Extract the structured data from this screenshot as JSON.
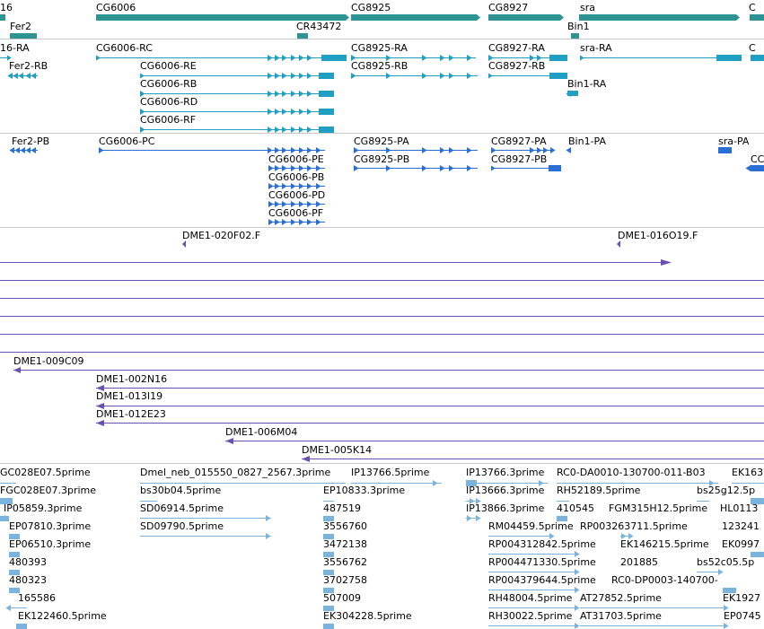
{
  "colors": {
    "gene": "#2e9393",
    "transcript": "#1f9fc1",
    "protein": "#2a6fd6",
    "clone": "#6a4fb5",
    "est": "#7ab3dd",
    "divider": "#c8c8c8"
  },
  "tracks": {
    "genes": {
      "labels": [
        "16",
        "CG6006",
        "CG8925",
        "CG8927",
        "sra",
        "C",
        "Fer2",
        "CR43472",
        "Bin1"
      ]
    },
    "transcripts": {
      "labels": [
        "16-RA",
        "CG6006-RC",
        "CG8925-RA",
        "CG8927-RA",
        "sra-RA",
        "C",
        "Fer2-RB",
        "CG6006-RE",
        "CG8925-RB",
        "CG8927-RB",
        "CG6006-RB",
        "Bin1-RA",
        "CG6006-RD",
        "CG6006-RF"
      ]
    },
    "proteins": {
      "labels": [
        "Fer2-PB",
        "CG6006-PC",
        "CG8925-PA",
        "CG8927-PA",
        "Bin1-PA",
        "sra-PA",
        "CC",
        "CG6006-PE",
        "CG8925-PB",
        "CG8927-PB",
        "CG6006-PB",
        "CG6006-PD",
        "CG6006-PF"
      ]
    },
    "clones": {
      "labels": [
        "DME1-020F02.F",
        "DME1-016O19.F",
        "DME1-009C09",
        "DME1-002N16",
        "DME1-013I19",
        "DME1-012E23",
        "DME1-006M04",
        "DME1-005K14"
      ]
    },
    "ests": {
      "labels": [
        "GC028E07.5prime",
        "Dmel_neb_015550_0827_2567.3prime",
        "IP13766.5prime",
        "IP13766.3prime",
        "RC0-DA0010-130700-011-B03",
        "EK163",
        "FGC028E07.3prime",
        "bs30b04.5prime",
        "EP10833.3prime",
        "IP13666.3prime",
        "RH52189.5prime",
        "bs25g12.5p",
        "IP05859.3prime",
        "SD06914.5prime",
        "487519",
        "IP13866.3prime",
        "410545",
        "FGM315H12.5prime",
        "HL0113",
        "EP07810.3prime",
        "SD09790.5prime",
        "3556760",
        "RM04459.5prime",
        "RP003263711.5prime",
        "123241",
        "EP06510.3prime",
        "3472138",
        "RP004312842.5prime",
        "EK146215.5prime",
        "EK0997",
        "480393",
        "3556762",
        "RP004471330.5prime",
        "201885",
        "bs52c05.5p",
        "480323",
        "3702758",
        "RP004379644.5prime",
        "RC0-DP0003-140700-",
        "165586",
        "507009",
        "RH48004.5prime",
        "AT27852.5prime",
        "EK1927",
        "EK122460.5prime",
        "EK304228.5prime",
        "RH30022.5prime",
        "AT31703.5prime",
        "EP0745"
      ]
    }
  }
}
